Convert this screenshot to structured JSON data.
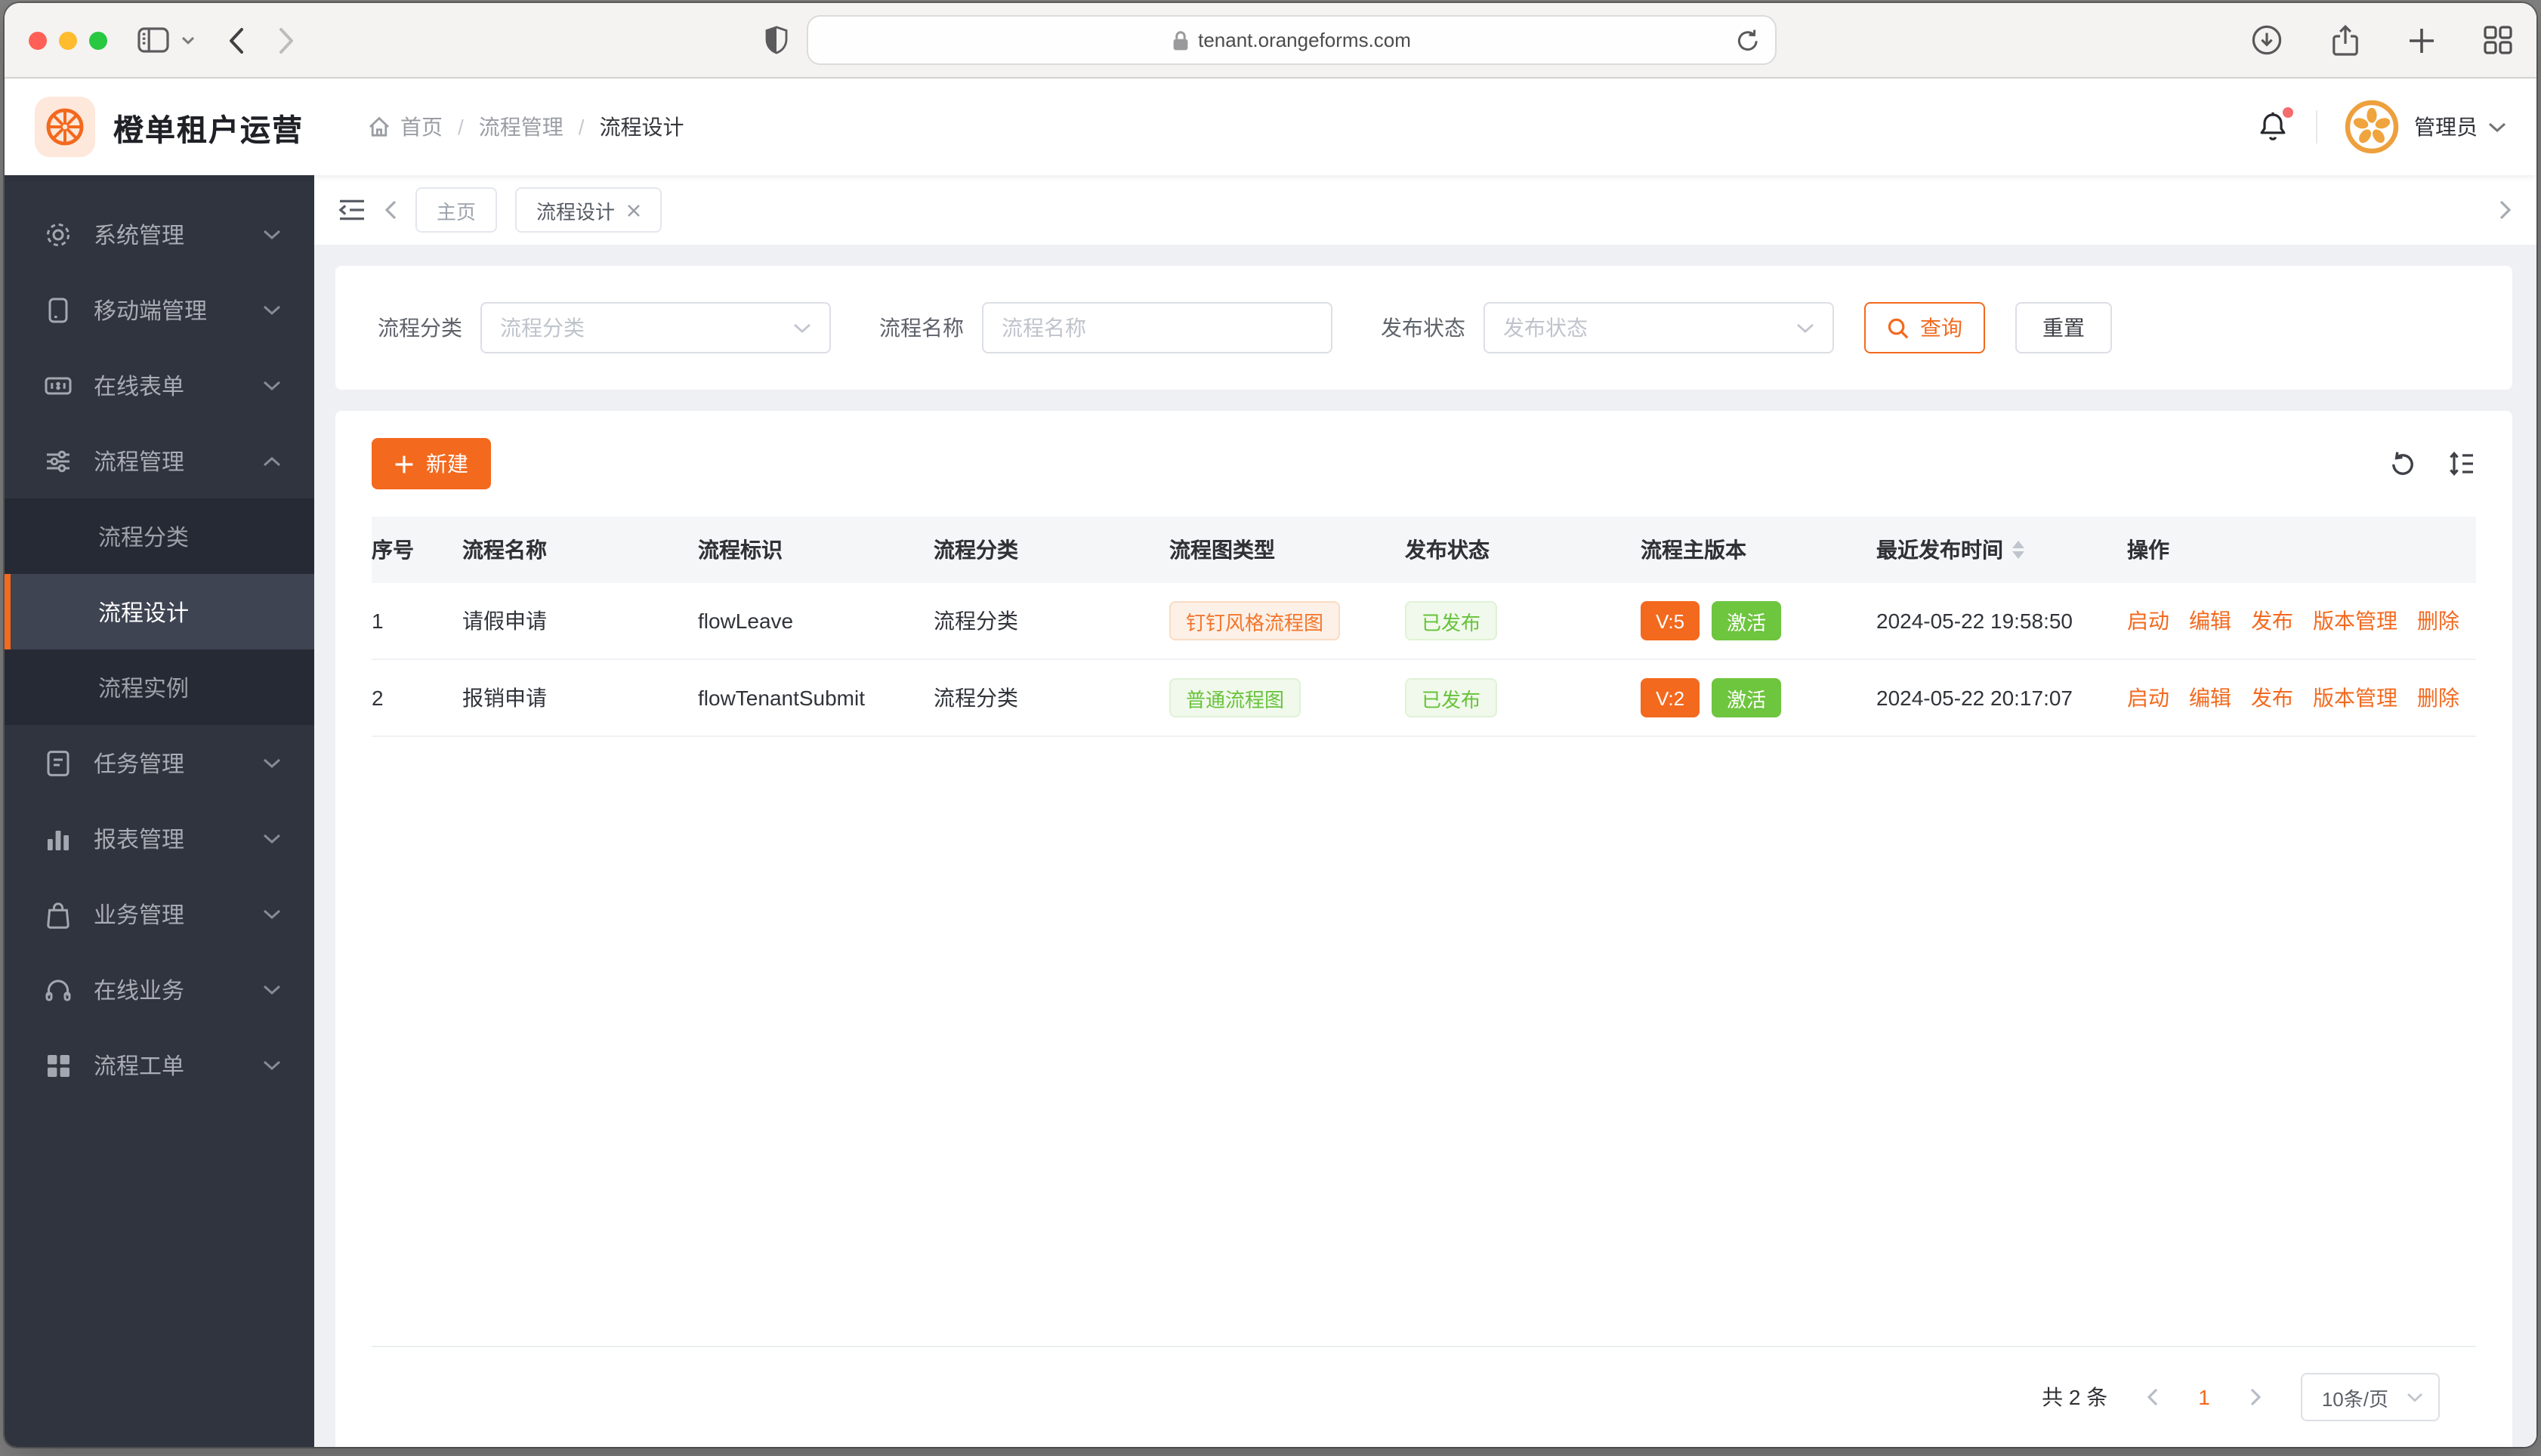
{
  "browser": {
    "url": "tenant.orangeforms.com"
  },
  "app": {
    "title": "橙单租户运营",
    "breadcrumb": {
      "home": "首页",
      "separator": "/",
      "section": "流程管理",
      "current": "流程设计"
    },
    "user": {
      "name": "管理员"
    }
  },
  "sidebar": {
    "items": [
      {
        "label": "系统管理"
      },
      {
        "label": "移动端管理"
      },
      {
        "label": "在线表单"
      },
      {
        "label": "流程管理",
        "children": [
          {
            "label": "流程分类"
          },
          {
            "label": "流程设计"
          },
          {
            "label": "流程实例"
          }
        ]
      },
      {
        "label": "任务管理"
      },
      {
        "label": "报表管理"
      },
      {
        "label": "业务管理"
      },
      {
        "label": "在线业务"
      },
      {
        "label": "流程工单"
      }
    ],
    "active_child": "流程设计"
  },
  "tabs": {
    "home": "主页",
    "active": "流程设计"
  },
  "filters": {
    "category_label": "流程分类",
    "category_placeholder": "流程分类",
    "name_label": "流程名称",
    "name_placeholder": "流程名称",
    "status_label": "发布状态",
    "status_placeholder": "发布状态",
    "search_button": "查询",
    "reset_button": "重置"
  },
  "toolbar": {
    "create_button": "新建"
  },
  "table": {
    "columns": [
      "序号",
      "流程名称",
      "流程标识",
      "流程分类",
      "流程图类型",
      "发布状态",
      "流程主版本",
      "最近发布时间",
      "操作"
    ],
    "actions": [
      "启动",
      "编辑",
      "发布",
      "版本管理",
      "删除"
    ],
    "rows": [
      {
        "index": "1",
        "name": "请假申请",
        "flow_key": "flowLeave",
        "category": "流程分类",
        "diagram_type": "钉钉风格流程图",
        "publish_status": "已发布",
        "main_version": "V:5",
        "version_status": "激活",
        "publish_time": "2024-05-22 19:58:50"
      },
      {
        "index": "2",
        "name": "报销申请",
        "flow_key": "flowTenantSubmit",
        "category": "流程分类",
        "diagram_type": "普通流程图",
        "publish_status": "已发布",
        "main_version": "V:2",
        "version_status": "激活",
        "publish_time": "2024-05-22 20:17:07"
      }
    ]
  },
  "pagination": {
    "total": "共 2 条",
    "page": "1",
    "page_size": "10条/页"
  },
  "colors": {
    "brand_orange": "#F3691E",
    "tag_orange_bg": "#FDF0E7",
    "tag_orange_text": "#F2762B",
    "success_green": "#67C23A",
    "tag_green_bg": "#F0F9EB",
    "solid_green": "#6EC53E",
    "notification_red": "#F56C6C",
    "sidebar_bg": "#30343F",
    "submenu_bg": "#262A34",
    "active_item_bg": "#3F4453"
  }
}
